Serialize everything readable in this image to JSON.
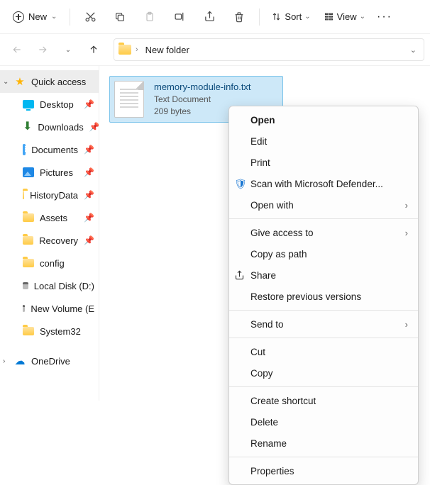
{
  "toolbar": {
    "new_label": "New",
    "sort_label": "Sort",
    "view_label": "View"
  },
  "breadcrumb": {
    "path": "New folder"
  },
  "sidebar": {
    "quick_access": "Quick access",
    "items": [
      {
        "label": "Desktop",
        "icon": "desktop",
        "pinned": true
      },
      {
        "label": "Downloads",
        "icon": "download",
        "pinned": true
      },
      {
        "label": "Documents",
        "icon": "docs",
        "pinned": true
      },
      {
        "label": "Pictures",
        "icon": "pics",
        "pinned": true
      },
      {
        "label": "HistoryData",
        "icon": "folder",
        "pinned": true
      },
      {
        "label": "Assets",
        "icon": "folder",
        "pinned": true
      },
      {
        "label": "Recovery",
        "icon": "folder",
        "pinned": true
      },
      {
        "label": "config",
        "icon": "folder",
        "pinned": false
      },
      {
        "label": "Local Disk (D:)",
        "icon": "disk",
        "pinned": false
      },
      {
        "label": "New Volume (E",
        "icon": "disk",
        "pinned": false
      },
      {
        "label": "System32",
        "icon": "folder",
        "pinned": false
      }
    ],
    "onedrive": "OneDrive"
  },
  "file": {
    "name": "memory-module-info.txt",
    "type": "Text Document",
    "size": "209 bytes"
  },
  "context_menu": {
    "open": "Open",
    "edit": "Edit",
    "print": "Print",
    "defender": "Scan with Microsoft Defender...",
    "open_with": "Open with",
    "give_access": "Give access to",
    "copy_path": "Copy as path",
    "share": "Share",
    "restore": "Restore previous versions",
    "send_to": "Send to",
    "cut": "Cut",
    "copy": "Copy",
    "shortcut": "Create shortcut",
    "delete": "Delete",
    "rename": "Rename",
    "properties": "Properties"
  }
}
